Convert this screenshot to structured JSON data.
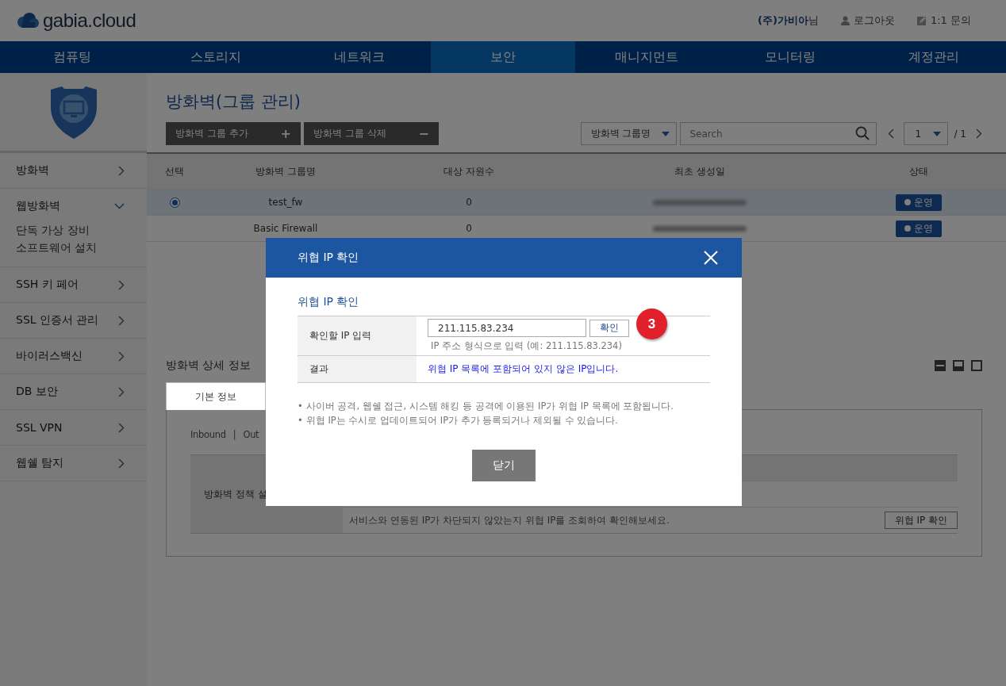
{
  "header": {
    "logo": "gabia.cloud",
    "user": "(주)가비아",
    "user_suffix": "님",
    "logout": "로그아웃",
    "inquiry": "1:1 문의"
  },
  "nav": [
    {
      "label": "컴퓨팅",
      "selected": false
    },
    {
      "label": "스토리지",
      "selected": false
    },
    {
      "label": "네트워크",
      "selected": false
    },
    {
      "label": "보안",
      "selected": true
    },
    {
      "label": "매니지먼트",
      "selected": false
    },
    {
      "label": "모니터링",
      "selected": false
    },
    {
      "label": "계정관리",
      "selected": false
    }
  ],
  "sidebar": {
    "items": [
      {
        "label": "방화벽",
        "expanded": false
      },
      {
        "label": "웹방화벽",
        "expanded": true,
        "children": [
          {
            "label": "단독 가상 장비"
          },
          {
            "label": "소프트웨어 설치"
          }
        ]
      },
      {
        "label": "SSH 키 페어",
        "expanded": false
      },
      {
        "label": "SSL 인증서 관리",
        "expanded": false
      },
      {
        "label": "바이러스백신",
        "expanded": false
      },
      {
        "label": "DB 보안",
        "expanded": false
      },
      {
        "label": "SSL VPN",
        "expanded": false
      },
      {
        "label": "웹쉘 탐지",
        "expanded": false
      }
    ]
  },
  "page_title": "방화벽(그룹 관리)",
  "toolbar": {
    "add_button": "방화벽 그룹 추가",
    "add_icon": "+",
    "delete_button": "방화벽 그룹 삭제",
    "delete_icon": "−",
    "filter": "방화벽 그룹명",
    "search_placeholder": "Search",
    "page": "1",
    "page_total": "/ 1"
  },
  "table": {
    "columns": [
      "선택",
      "방화벽 그룹명",
      "대상 자원수",
      "최초 생성일",
      "상태"
    ],
    "rows": [
      {
        "selected": true,
        "name": "test_fw",
        "count": "0",
        "status": "운영"
      },
      {
        "selected": false,
        "name": "Basic Firewall",
        "count": "0",
        "status": "운영"
      }
    ]
  },
  "detail": {
    "title": "방화벽 상세 정보",
    "tab": "기본 정보",
    "inbound": "Inbound",
    "separator": "|",
    "outbound": "Out",
    "policy_label": "방화벽 정책 설",
    "hint": "서비스와 연동된 IP가 차단되지 않았는지 위협 IP를 조회하여 확인해보세요.",
    "check_button": "위협 IP 확인"
  },
  "modal": {
    "title": "위협 IP 확인",
    "section_title": "위협 IP 확인",
    "input_label": "확인할 IP 입력",
    "ip_value": "211.115.83.234",
    "confirm_button": "확인",
    "input_hint": "IP 주소 형식으로 입력 (예: 211.115.83.234)",
    "result_label": "결과",
    "result": "위협 IP 목록에 포함되어 있지 않은 IP입니다.",
    "notes": [
      {
        "bullet": "•",
        "text": "사이버 공격, 웹쉘 접근, 시스템 해킹 등 공격에 이용된 IP가 위협 IP 목록에 포함됩니다."
      },
      {
        "bullet": "•",
        "text": "위협 IP는 수시로 업데이트되어 IP가 추가 등록되거나 제외될 수 있습니다."
      }
    ],
    "close_button": "닫기",
    "step_badge": "3"
  }
}
